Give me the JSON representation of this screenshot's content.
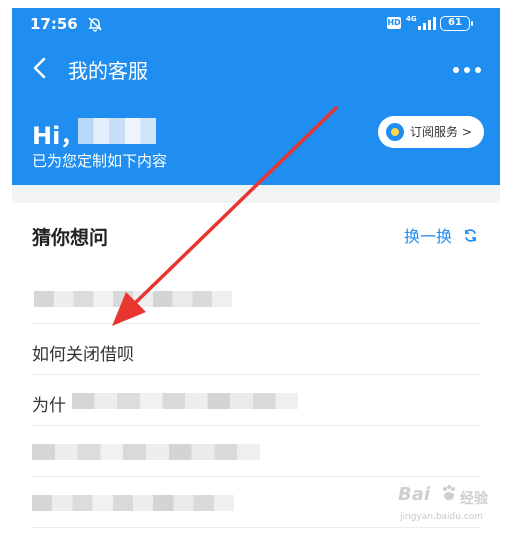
{
  "status": {
    "time": "17:56",
    "hd": "HD",
    "network": "4G",
    "battery": "61"
  },
  "header": {
    "title": "我的客服"
  },
  "greeting": {
    "hi": "Hi，",
    "subtitle": "已为您定制如下内容",
    "subscribe_label": "订阅服务 >"
  },
  "guess": {
    "title": "猜你想问",
    "refresh_label": "换一换",
    "questions": [
      {
        "visible_text": ""
      },
      {
        "visible_text": "如何关闭借呗"
      },
      {
        "visible_text": "为什"
      },
      {
        "visible_text": ""
      },
      {
        "visible_text": ""
      }
    ]
  },
  "watermark": {
    "brand": "Bai",
    "brand_rest": "经验",
    "url": "jingyan.baidu.com"
  },
  "colors": {
    "primary": "#1f8ef0",
    "annotation": "#e8352f"
  }
}
